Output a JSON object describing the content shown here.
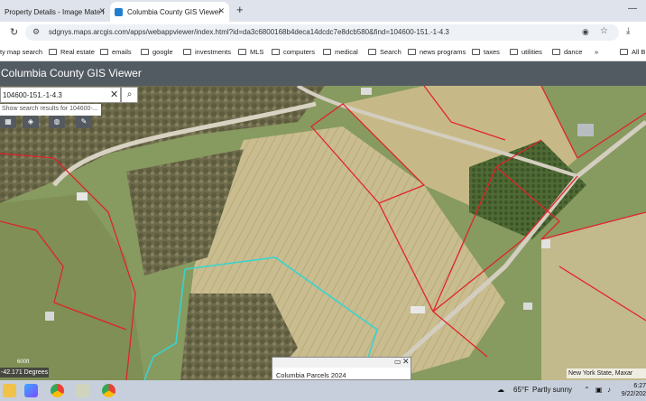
{
  "browser": {
    "tabs": [
      {
        "label": "Property Details - Image Mate I",
        "active": false
      },
      {
        "label": "Columbia County GIS Viewer",
        "active": true
      }
    ],
    "new_tab_glyph": "+",
    "address": {
      "url": "sdgnys.maps.arcgis.com/apps/webappviewer/index.html?id=da3c6800168b4deca14dcdc7e8dcb580&find=104600-151.-1-4.3"
    },
    "bookmarks": [
      "ty map search",
      "Real estate",
      "emails",
      "google",
      "investments",
      "MLS",
      "computers",
      "medical",
      "Search",
      "news programs",
      "taxes",
      "utilities",
      "dance",
      "All B"
    ],
    "bookmarks_overflow": "»"
  },
  "app": {
    "title": "Columbia County GIS Viewer",
    "search": {
      "value": "104600-151.-1-4.3",
      "suggestion": "Show search results for 104600-..."
    },
    "coordinates": "-42.171 Degrees",
    "scale_label": "600ft",
    "attribution": "New York State, Maxar",
    "popup": {
      "title": "Columbia Parcels 2024"
    }
  },
  "taskbar": {
    "weather_temp": "65°F",
    "weather_desc": "Partly sunny",
    "time": "6:27",
    "date": "9/22/202"
  },
  "colors": {
    "parcel_line": "#e0242a",
    "selected_parcel": "#38d4d0",
    "app_header": "#525a62",
    "tab_strip": "#dfe3eb"
  }
}
